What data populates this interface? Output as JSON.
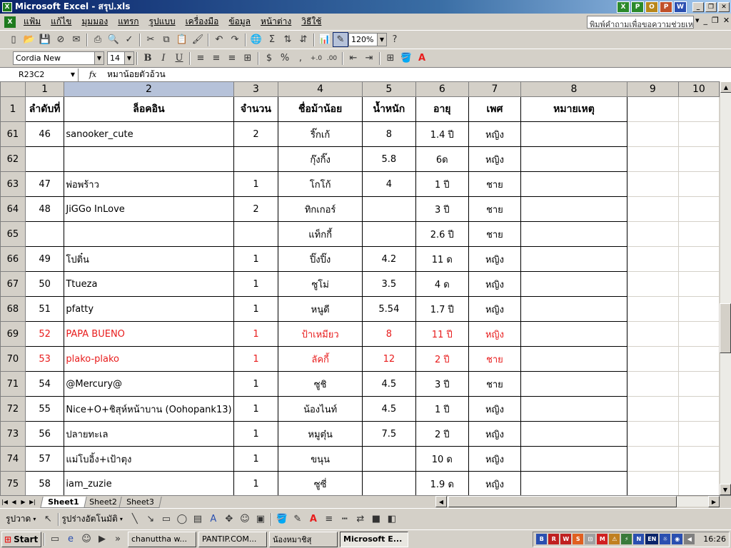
{
  "window": {
    "title": "Microsoft Excel - สรุป.xls"
  },
  "menu": {
    "items": [
      "แฟ้ม",
      "แก้ไข",
      "มุมมอง",
      "แทรก",
      "รูปแบบ",
      "เครื่องมือ",
      "ข้อมูล",
      "หน้าต่าง",
      "วิธีใช้"
    ],
    "help_placeholder": "พิมพ์คำถามเพื่อขอความช่วยเหลือ"
  },
  "toolbar": {
    "zoom": "120%",
    "font_name": "Cordia New",
    "font_size": "14"
  },
  "formula": {
    "name_box": "R23C2",
    "fx": "fx",
    "content": "หมาน้อยตัวอ้วน"
  },
  "columns": [
    "1",
    "2",
    "3",
    "4",
    "5",
    "6",
    "7",
    "8",
    "9",
    "10"
  ],
  "header_row": {
    "row_number": "1",
    "cells": [
      "ลำดับที่",
      "ล็อคอิน",
      "จำนวน",
      "ชื่อม้าน้อย",
      "น้ำหนัก",
      "อายุ",
      "เพศ",
      "หมายเหตุ"
    ]
  },
  "rows": [
    {
      "n": "61",
      "seq": "46",
      "login": "sanooker_cute",
      "count": "2",
      "name": "ริ๊กเก้",
      "weight": "8",
      "age": "1.4 ปี",
      "sex": "หญิง"
    },
    {
      "n": "62",
      "seq": "",
      "login": "",
      "count": "",
      "name": "กุ๊งกิ๊ง",
      "weight": "5.8",
      "age": "6ด",
      "sex": "หญิง"
    },
    {
      "n": "63",
      "seq": "47",
      "login": "พ่อพร้าว",
      "count": "1",
      "name": "โกโก้",
      "weight": "4",
      "age": "1 ปี",
      "sex": "ชาย"
    },
    {
      "n": "64",
      "seq": "48",
      "login": "JiGGo InLove",
      "count": "2",
      "name": "ทิกเกอร์",
      "weight": "",
      "age": "3 ปี",
      "sex": "ชาย"
    },
    {
      "n": "65",
      "seq": "",
      "login": "",
      "count": "",
      "name": "แท็กกี้",
      "weight": "",
      "age": "2.6 ปี",
      "sex": "ชาย"
    },
    {
      "n": "66",
      "seq": "49",
      "login": "โปติ๋น",
      "count": "1",
      "name": "ปิ๊งปิ๊ง",
      "weight": "4.2",
      "age": "11 ด",
      "sex": "หญิง"
    },
    {
      "n": "67",
      "seq": "50",
      "login": "Ttueza",
      "count": "1",
      "name": "ซูโม่",
      "weight": "3.5",
      "age": "4 ด",
      "sex": "หญิง"
    },
    {
      "n": "68",
      "seq": "51",
      "login": "pfatty",
      "count": "1",
      "name": "หนูดี",
      "weight": "5.54",
      "age": "1.7 ปี",
      "sex": "หญิง"
    },
    {
      "n": "69",
      "seq": "52",
      "login": "PAPA BUENO",
      "count": "1",
      "name": "ป้าเหมียว",
      "weight": "8",
      "age": "11 ปี",
      "sex": "หญิง",
      "red": true
    },
    {
      "n": "70",
      "seq": "53",
      "login": "plako-plako",
      "count": "1",
      "name": "ลัคกี้",
      "weight": "12",
      "age": "2 ปี",
      "sex": "ชาย",
      "red": true
    },
    {
      "n": "71",
      "seq": "54",
      "login": "@Mercury@",
      "count": "1",
      "name": "ซูชิ",
      "weight": "4.5",
      "age": "3 ปี",
      "sex": "ชาย"
    },
    {
      "n": "72",
      "seq": "55",
      "login": "Nice+O+ชิสุห์หน้าบาน (Oohopank13)",
      "count": "1",
      "name": "น้องไนท์",
      "weight": "4.5",
      "age": "1 ปี",
      "sex": "หญิง"
    },
    {
      "n": "73",
      "seq": "56",
      "login": "ปลายทะเล",
      "count": "1",
      "name": "หมูตุ๋น",
      "weight": "7.5",
      "age": "2 ปี",
      "sex": "หญิง"
    },
    {
      "n": "74",
      "seq": "57",
      "login": "แม่โบอิ้ง+เป้าตุง",
      "count": "1",
      "name": "ขนุน",
      "weight": "",
      "age": "10 ด",
      "sex": "หญิง"
    },
    {
      "n": "75",
      "seq": "58",
      "login": "iam_zuzie",
      "count": "1",
      "name": "ซูซี่",
      "weight": "",
      "age": "1.9 ด",
      "sex": "หญิง"
    }
  ],
  "sheets": [
    "Sheet1",
    "Sheet2",
    "Sheet3"
  ],
  "drawing": {
    "draw_label": "รูปวาด",
    "autoshapes_label": "รูปร่างอัตโนมัติ"
  },
  "taskbar": {
    "start": "Start",
    "tasks": [
      "chanuttha w...",
      "PANTIP.COM...",
      "น้องหมาชิสุ",
      "Microsoft E..."
    ],
    "clock": "16:26",
    "lang": "EN"
  },
  "colors": {
    "red_text": "#e81c1c",
    "title_blue": "#0a246a"
  }
}
